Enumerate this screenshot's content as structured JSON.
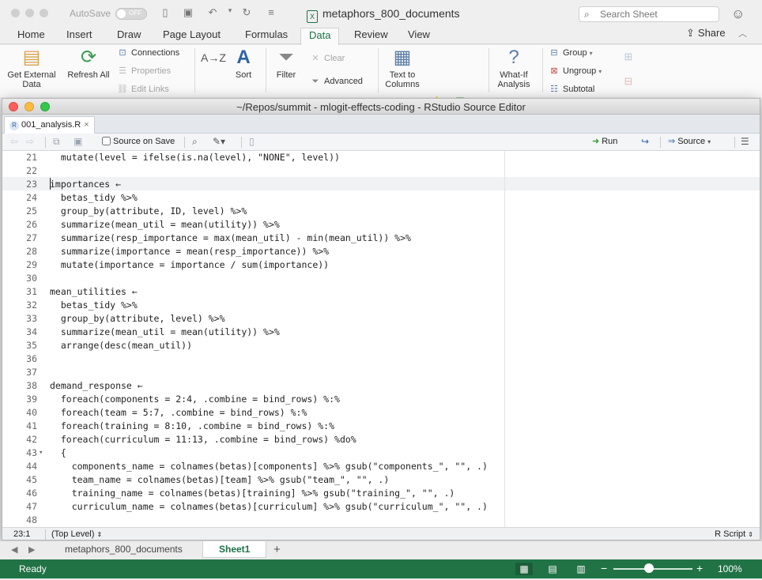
{
  "excel": {
    "autosave_label": "AutoSave",
    "autosave_state": "OFF",
    "doc_title": "metaphors_800_documents",
    "search_placeholder": "Search Sheet",
    "tabs": [
      "Home",
      "Insert",
      "Draw",
      "Page Layout",
      "Formulas",
      "Data",
      "Review",
      "View"
    ],
    "active_tab": "Data",
    "share_label": "Share",
    "ribbon": {
      "get_external_data": "Get External Data",
      "refresh_all": "Refresh All",
      "connections": "Connections",
      "properties": "Properties",
      "edit_links": "Edit Links",
      "sort_az": "A→Z",
      "sort": "Sort",
      "filter": "Filter",
      "clear": "Clear",
      "advanced": "Advanced",
      "text_to_columns": "Text to Columns",
      "what_if": "What-If Analysis",
      "group": "Group",
      "ungroup": "Ungroup",
      "subtotal": "Subtotal"
    },
    "sheet_tabs": [
      "metaphors_800_documents",
      "Sheet1"
    ],
    "active_sheet": "Sheet1",
    "status": "Ready",
    "zoom": "100%",
    "zoom_level": 0.45,
    "accent_color": "#217346"
  },
  "rstudio": {
    "window_title": "~/Repos/summit - mlogit-effects-coding - RStudio Source Editor",
    "file_tab": "001_analysis.R",
    "source_on_save": "Source on Save",
    "source_on_save_checked": false,
    "run_label": "Run",
    "source_label": "Source",
    "cursor_position": "23:1",
    "scope": "(Top Level)",
    "file_type": "R Script",
    "code_lines": [
      {
        "n": "21",
        "fold": "",
        "text": "  mutate(level = ifelse(is.na(level), \"NONE\", level))"
      },
      {
        "n": "22",
        "fold": "",
        "text": ""
      },
      {
        "n": "23",
        "fold": "",
        "text": "importances ←"
      },
      {
        "n": "24",
        "fold": "",
        "text": "  betas_tidy %>%"
      },
      {
        "n": "25",
        "fold": "",
        "text": "  group_by(attribute, ID, level) %>%"
      },
      {
        "n": "26",
        "fold": "",
        "text": "  summarize(mean_util = mean(utility)) %>%"
      },
      {
        "n": "27",
        "fold": "",
        "text": "  summarize(resp_importance = max(mean_util) - min(mean_util)) %>%"
      },
      {
        "n": "28",
        "fold": "",
        "text": "  summarize(importance = mean(resp_importance)) %>%"
      },
      {
        "n": "29",
        "fold": "",
        "text": "  mutate(importance = importance / sum(importance))"
      },
      {
        "n": "30",
        "fold": "",
        "text": ""
      },
      {
        "n": "31",
        "fold": "",
        "text": "mean_utilities ←"
      },
      {
        "n": "32",
        "fold": "",
        "text": "  betas_tidy %>%"
      },
      {
        "n": "33",
        "fold": "",
        "text": "  group_by(attribute, level) %>%"
      },
      {
        "n": "34",
        "fold": "",
        "text": "  summarize(mean_util = mean(utility)) %>%"
      },
      {
        "n": "35",
        "fold": "",
        "text": "  arrange(desc(mean_util))"
      },
      {
        "n": "36",
        "fold": "",
        "text": ""
      },
      {
        "n": "37",
        "fold": "",
        "text": ""
      },
      {
        "n": "38",
        "fold": "",
        "text": "demand_response ←"
      },
      {
        "n": "39",
        "fold": "",
        "text": "  foreach(components = 2:4, .combine = bind_rows) %:%"
      },
      {
        "n": "40",
        "fold": "",
        "text": "  foreach(team = 5:7, .combine = bind_rows) %:%"
      },
      {
        "n": "41",
        "fold": "",
        "text": "  foreach(training = 8:10, .combine = bind_rows) %:%"
      },
      {
        "n": "42",
        "fold": "",
        "text": "  foreach(curriculum = 11:13, .combine = bind_rows) %do%"
      },
      {
        "n": "43",
        "fold": "▾",
        "text": "  {"
      },
      {
        "n": "44",
        "fold": "",
        "text": "    components_name = colnames(betas)[components] %>% gsub(\"components_\", \"\", .)"
      },
      {
        "n": "45",
        "fold": "",
        "text": "    team_name = colnames(betas)[team] %>% gsub(\"team_\", \"\", .)"
      },
      {
        "n": "46",
        "fold": "",
        "text": "    training_name = colnames(betas)[training] %>% gsub(\"training_\", \"\", .)"
      },
      {
        "n": "47",
        "fold": "",
        "text": "    curriculum_name = colnames(betas)[curriculum] %>% gsub(\"curriculum_\", \"\", .)"
      },
      {
        "n": "48",
        "fold": "",
        "text": ""
      }
    ]
  }
}
